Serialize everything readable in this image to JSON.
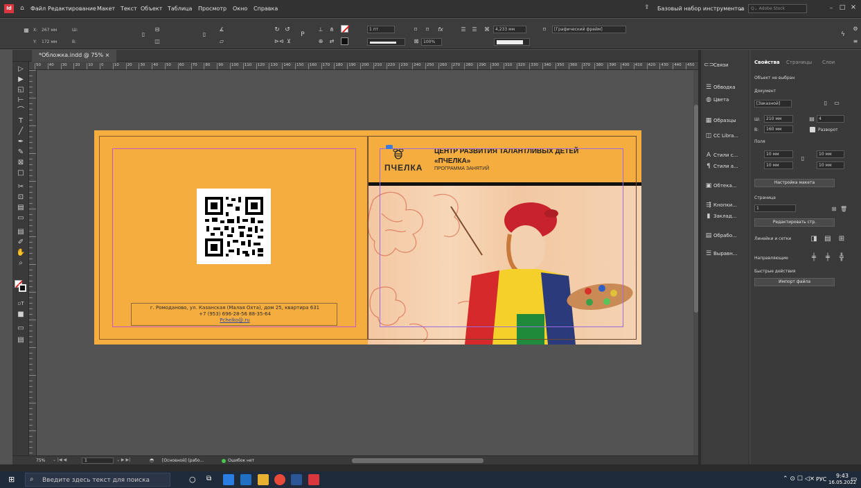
{
  "menubar": {
    "app_badge": "Id",
    "items": [
      "Файл",
      "Редактирование",
      "Макет",
      "Текст",
      "Объект",
      "Таблица",
      "Просмотр",
      "Окно",
      "Справка"
    ],
    "workspace": "Базовый набор инструментов",
    "search_placeholder": "Adobe Stock"
  },
  "control": {
    "x_label": "X:",
    "x_value": "267 мм",
    "y_label": "Y:",
    "y_value": "172 мм",
    "w_label": "Ш:",
    "h_label": "В:",
    "stroke_weight": "1 пт",
    "zoom_percent": "100%",
    "size_value": "4,233 мм",
    "frame_style": "[Графический фрейм]"
  },
  "document": {
    "tab_label": "*Обложка.indd @ 75%"
  },
  "ruler": {
    "h_ticks": [
      "50",
      "40",
      "30",
      "20",
      "10",
      "0",
      "10",
      "20",
      "30",
      "40",
      "50",
      "60",
      "70",
      "80",
      "90",
      "100",
      "110",
      "120",
      "130",
      "140",
      "150",
      "160",
      "170",
      "180",
      "190",
      "200",
      "210",
      "220",
      "230",
      "240",
      "250",
      "260",
      "270",
      "280",
      "290",
      "300",
      "310",
      "320",
      "330",
      "340",
      "350",
      "360",
      "370",
      "380",
      "390",
      "400",
      "410",
      "420",
      "430",
      "440",
      "450",
      "460"
    ]
  },
  "cover": {
    "heading_line1": "ЦЕНТР РАЗВИТИЯ ТАЛАНТЛИВЫХ ДЕТЕЙ",
    "heading_line2": "«ПЧЕЛКА»",
    "subheading": "ПРОГРАММА ЗАНЯТИЙ",
    "logo_text": "ПЧЕЛКА",
    "address_line1": "г. Ромоданово, ул. Казанская (Малая Охта), дом 25, квартира 631",
    "address_line2": "+7 (953) 696-28-56    88-35-64",
    "email": "Pchelko@.ru"
  },
  "statusbar": {
    "zoom": "75%",
    "page": "1",
    "mode": "[Основной] (рабо...",
    "preflight": "Ошибок нет"
  },
  "panels": {
    "items": [
      {
        "label": "Связи",
        "icon": "links-icon",
        "glyph": "⊂⊃"
      },
      {
        "label": "Обводка",
        "icon": "stroke-icon",
        "glyph": "☰"
      },
      {
        "label": "Цвета",
        "icon": "swatches-icon",
        "glyph": "◍"
      },
      {
        "label": "Образцы",
        "icon": "samples-icon",
        "glyph": "▦"
      },
      {
        "label": "CC Libra...",
        "icon": "libraries-icon",
        "glyph": "◫"
      },
      {
        "label": "Стили с...",
        "icon": "char-styles-icon",
        "glyph": "A"
      },
      {
        "label": "Стили а...",
        "icon": "para-styles-icon",
        "glyph": "¶"
      },
      {
        "label": "Обтека...",
        "icon": "wrap-icon",
        "glyph": "▣"
      },
      {
        "label": "Кнопки...",
        "icon": "buttons-icon",
        "glyph": "⇶"
      },
      {
        "label": "Заклад...",
        "icon": "bookmarks-icon",
        "glyph": "▮"
      },
      {
        "label": "Обрабо...",
        "icon": "process-icon",
        "glyph": "▤"
      },
      {
        "label": "Выравн...",
        "icon": "align-icon",
        "glyph": "☰"
      }
    ]
  },
  "properties": {
    "tabs": [
      "Свойства",
      "Страницы",
      "Слои"
    ],
    "no_selection": "Объект не выбран",
    "document_label": "Документ",
    "preset": "[Заказной]",
    "width_label": "Ш:",
    "width_value": "210 мм",
    "height_label": "В:",
    "height_value": "160 мм",
    "pages_value": "4",
    "spread_label": "Разворот",
    "margins_label": "Поля",
    "margin_value": "10 мм",
    "layout_btn": "Настройка макета",
    "page_label": "Страница",
    "page_value": "1",
    "edit_page_btn": "Редактировать стр.",
    "rulers_label": "Линейки и сетки",
    "guides_label": "Направляющие",
    "quick_label": "Быстрые действия",
    "import_btn": "Импорт файла"
  },
  "taskbar": {
    "search_placeholder": "Введите здесь текст для поиска",
    "lang": "РУС",
    "time": "9:43",
    "date": "16.05.2022"
  },
  "colors": {
    "cover_orange": "#f6ad3f",
    "panel_dark": "#3a3a3a",
    "app_red": "#d9363e"
  }
}
